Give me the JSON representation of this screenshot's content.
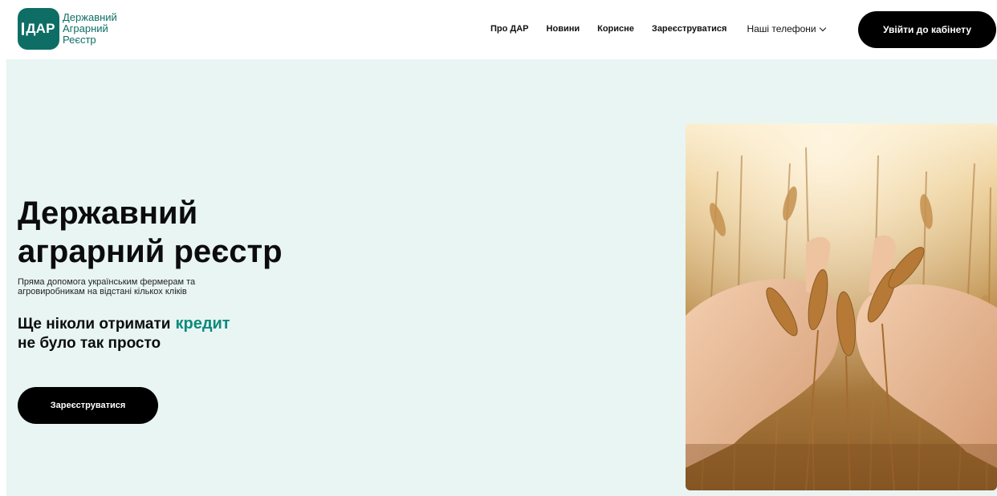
{
  "header": {
    "logo": {
      "badge": "ДАР",
      "lines": [
        "Державний",
        "Аграрний",
        "Реєстр"
      ]
    },
    "nav": {
      "about": "Про ДАР",
      "news": "Новини",
      "useful": "Корисне",
      "register": "Зареєструватися",
      "phones": "Наші телефони"
    },
    "login_label": "Увійти до кабінету"
  },
  "hero": {
    "title_line1": "Державний",
    "title_line2": "аграрний реєстр",
    "subtitle_line1": "Пряма допомога українським фермерам та",
    "subtitle_line2": "агровиробникам на відстані кількох кліків",
    "tag_part1": "Ще ніколи отримати",
    "tag_accent": "кредит",
    "tag_line2": "не було так просто",
    "cta_label": "Зареєструватися"
  },
  "colors": {
    "brand": "#0e6e66",
    "accent": "#0e8a7c",
    "hero_bg": "#e8f5f3",
    "button": "#000000"
  },
  "icons": {
    "phones_dropdown": "chevron-down-icon",
    "logo_mark": "wheat-ear-icon"
  }
}
